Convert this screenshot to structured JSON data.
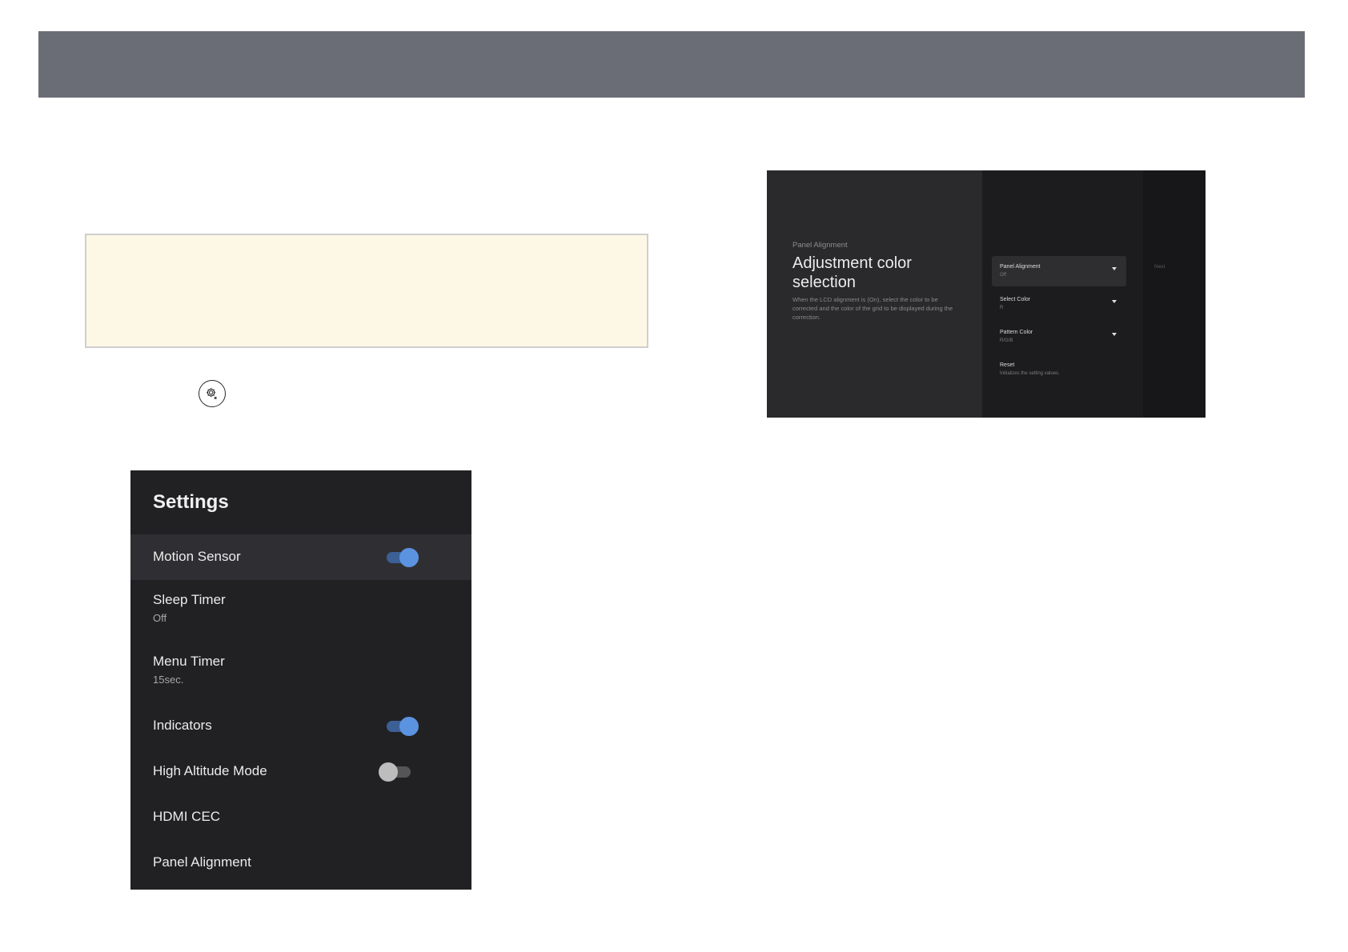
{
  "settings": {
    "title": "Settings",
    "items": [
      {
        "label": "Motion Sensor",
        "toggle": "on"
      },
      {
        "label": "Sleep Timer",
        "value": "Off"
      },
      {
        "label": "Menu Timer",
        "value": "15sec."
      },
      {
        "label": "Indicators",
        "toggle": "on"
      },
      {
        "label": "High Altitude Mode",
        "toggle": "off"
      },
      {
        "label": "HDMI CEC"
      },
      {
        "label": "Panel Alignment"
      }
    ]
  },
  "panel_alignment": {
    "breadcrumb": "Panel Alignment",
    "title": "Adjustment color selection",
    "description": "When the LCD alignment is (On), select the color to be corrected and the color of the grid to be displayed during the correction.",
    "options": [
      {
        "label": "Panel Alignment",
        "value": "Off"
      },
      {
        "label": "Select Color",
        "value": "R"
      },
      {
        "label": "Pattern Color",
        "value": "R/G/B"
      },
      {
        "label": "Reset",
        "value": "Initializes the setting values."
      }
    ],
    "next_label": "Next"
  },
  "icons": {
    "settings_button": "gear-icon"
  },
  "colors": {
    "header_band": "#6b6d76",
    "note_background": "#fdf8e6",
    "toggle_on": "#5b93e0"
  }
}
